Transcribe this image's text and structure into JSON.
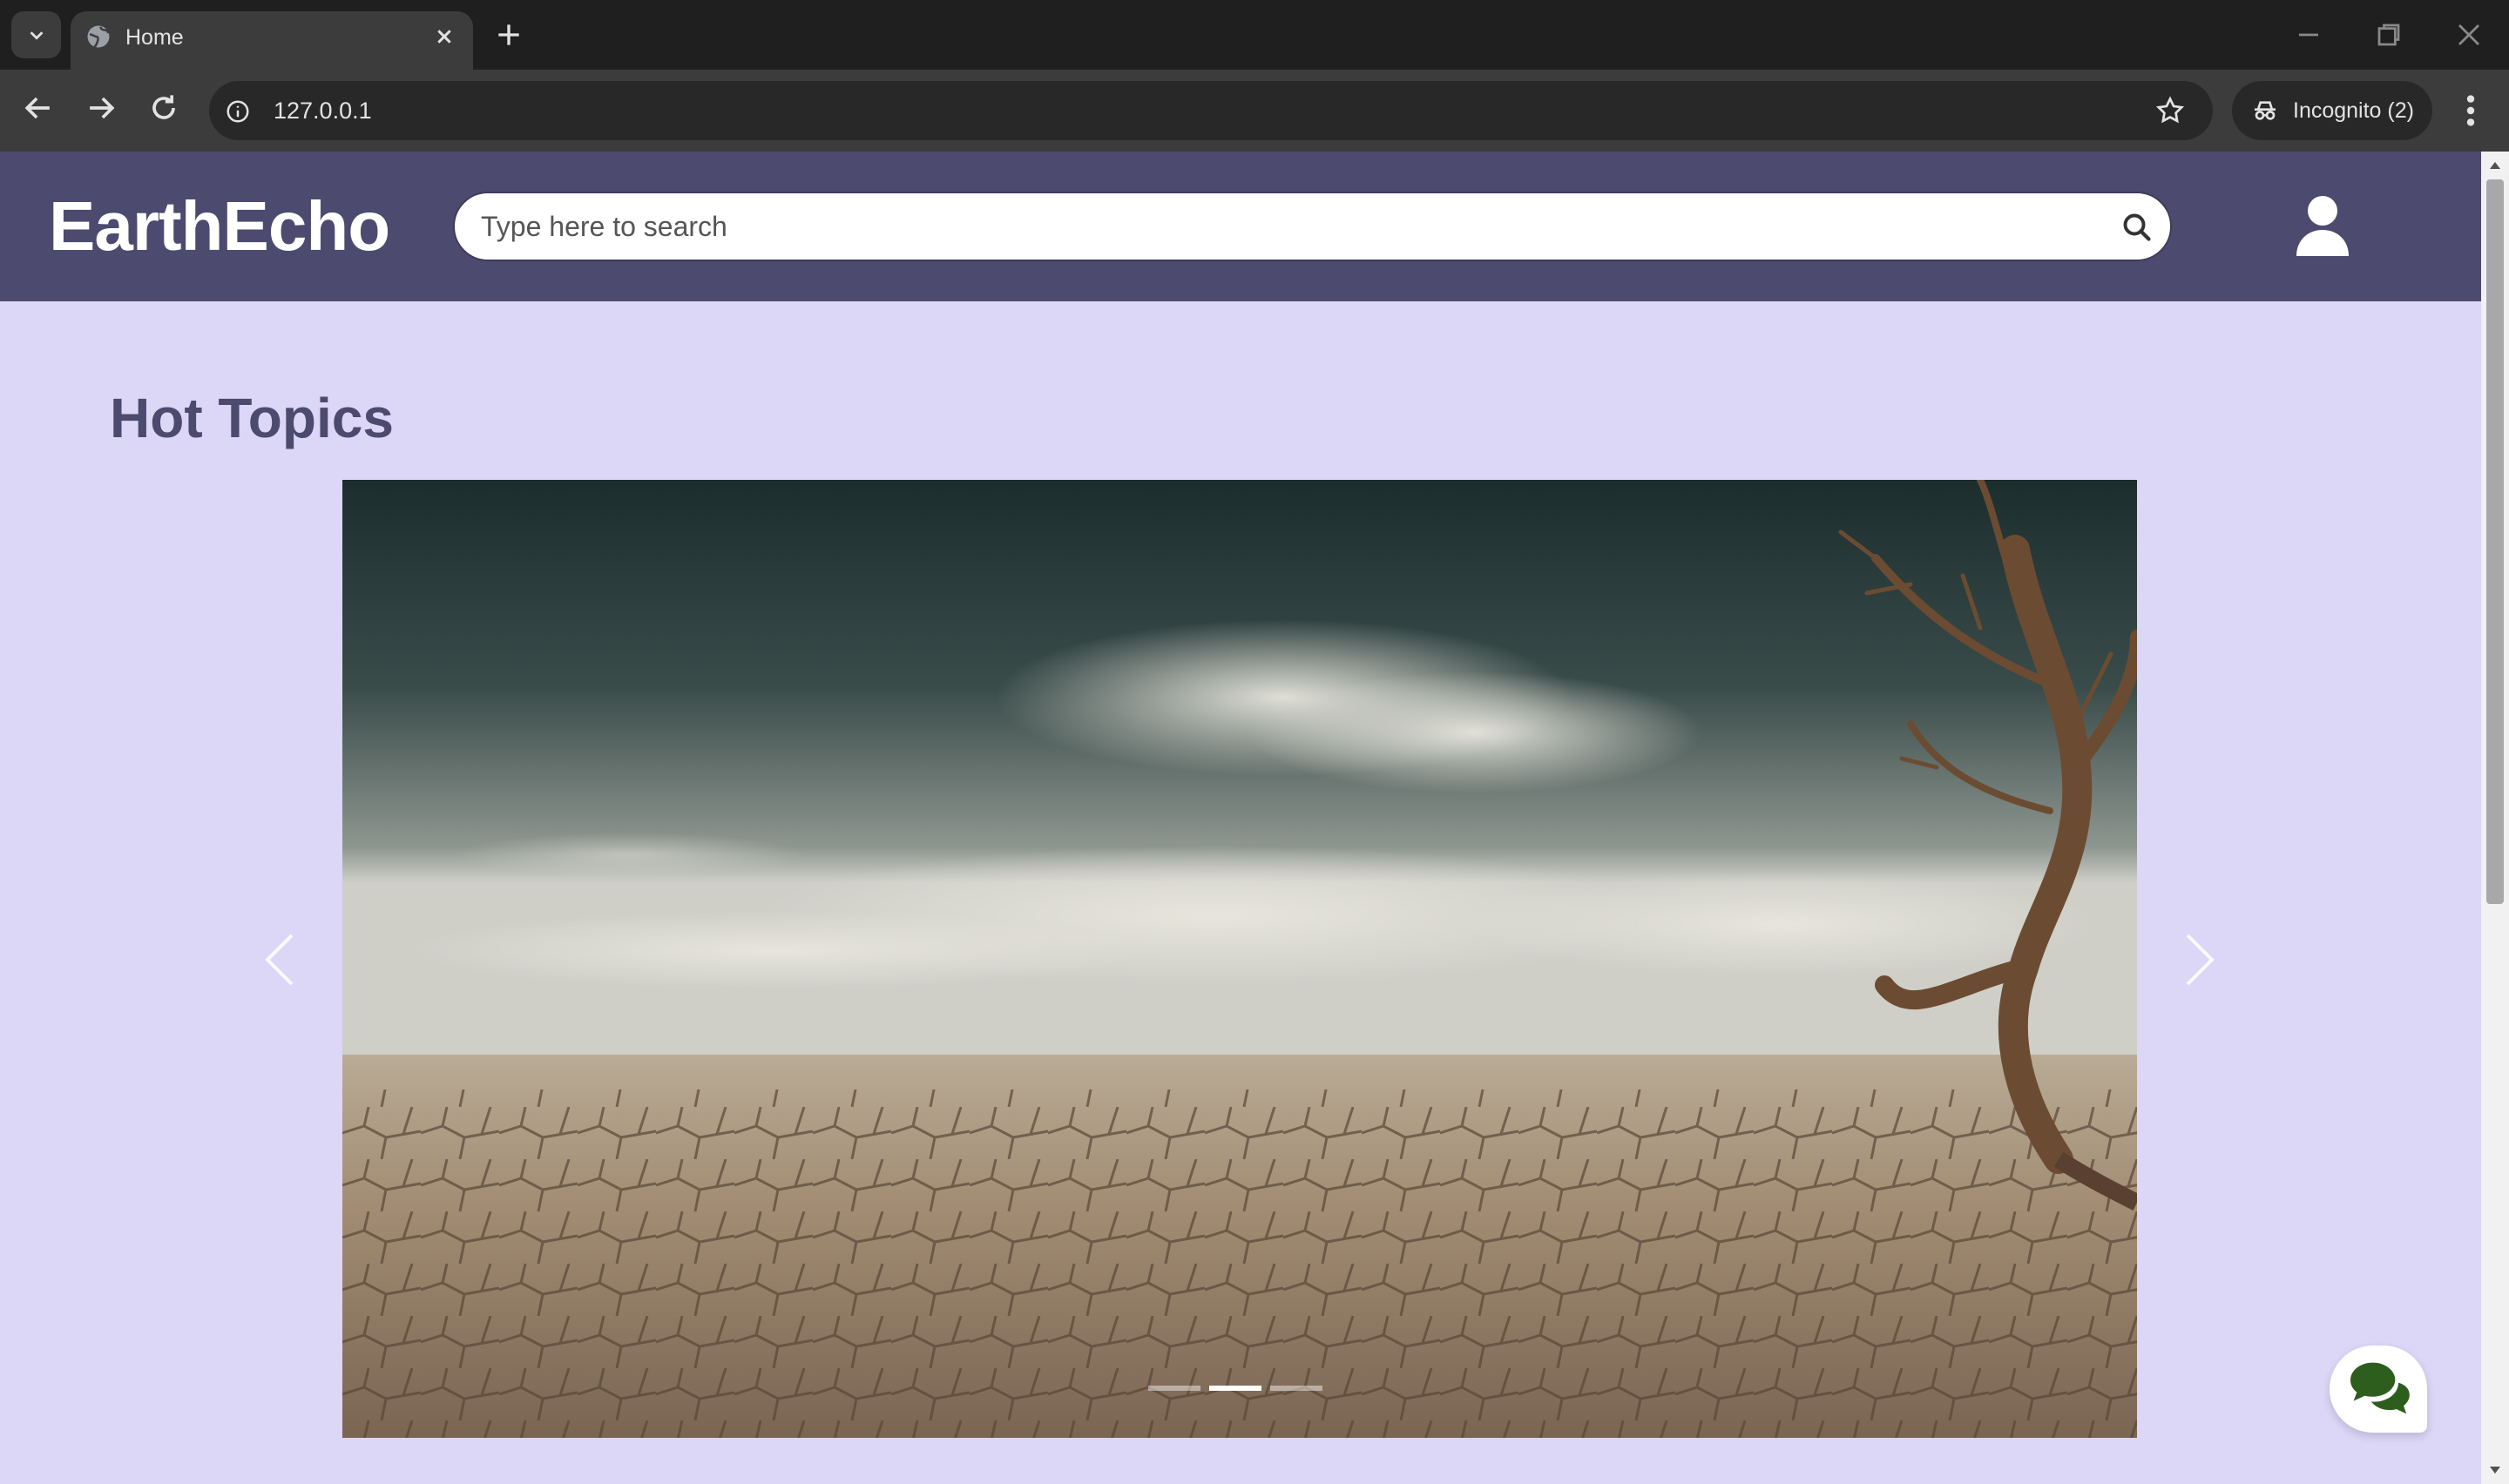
{
  "browser": {
    "tab": {
      "title": "Home",
      "favicon": "globe-icon"
    },
    "url": "127.0.0.1",
    "profile": "Incognito (2)"
  },
  "site": {
    "logo": "EarthEcho",
    "search": {
      "placeholder": "Type here to search",
      "value": ""
    },
    "account_icon": "user-icon"
  },
  "main": {
    "section_title": "Hot Topics",
    "carousel": {
      "slide_image": "cracked dry earth with dead tree",
      "slide_count": 3,
      "active_index": 1
    }
  },
  "chat": {
    "icon": "chat-bubbles-icon",
    "color": "#2e5e1e"
  },
  "colors": {
    "header": "#4c4a6e",
    "page_bg": "#dcd6f7",
    "title": "#4c4a6e"
  }
}
